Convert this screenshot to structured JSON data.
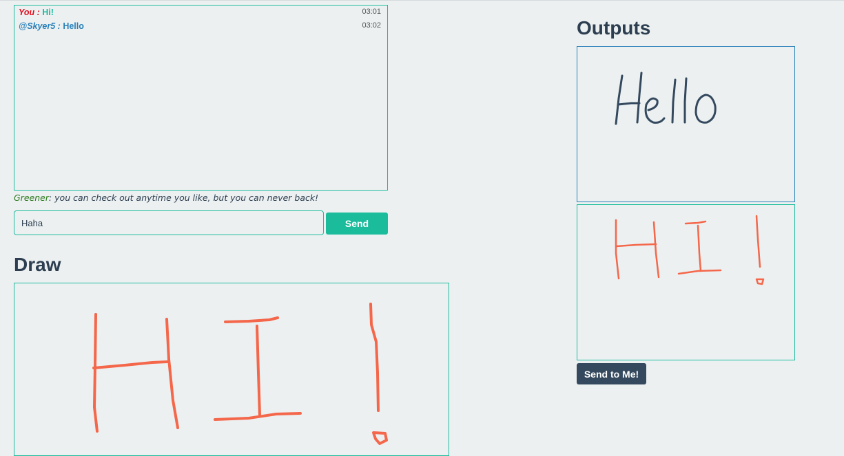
{
  "chat": {
    "messages": [
      {
        "sender": "You",
        "separator": " : ",
        "text": "Hi!",
        "time": "03:01"
      },
      {
        "sender": "@Skyer5",
        "separator": " : ",
        "text": "Hello",
        "time": "03:02"
      }
    ],
    "status_user": "Greener",
    "status_text": ": you can check out anytime you like, but you can never back!",
    "input_value": "Haha",
    "send_label": "Send"
  },
  "draw": {
    "heading": "Draw",
    "stroke_color": "#f4674a"
  },
  "outputs": {
    "heading": "Outputs",
    "send_to_me_label": "Send to Me!",
    "items": [
      "hello-drawing",
      "hi-drawing"
    ]
  },
  "colors": {
    "accent": "#1abc9c",
    "dark": "#34495e",
    "heading": "#2c3e50",
    "link": "#2980b9",
    "you": "#e20e1e"
  }
}
